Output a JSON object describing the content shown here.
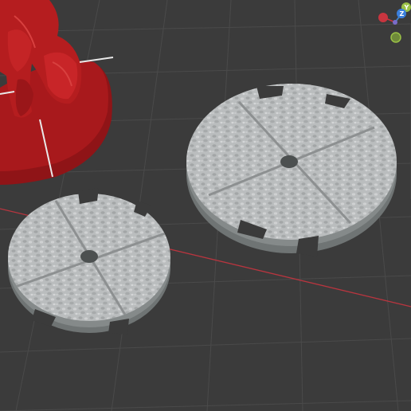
{
  "viewport": {
    "background": "#3b3b3b",
    "grid_color": "#4a4a4a",
    "x_axis_color": "#b8353f"
  },
  "scene": {
    "objects": [
      {
        "name": "miniature-figure",
        "color": "#a8191c"
      },
      {
        "name": "large-textured-base",
        "color": "#b9bcbd"
      },
      {
        "name": "small-textured-base",
        "color": "#b9bcbd"
      }
    ]
  },
  "view_gizmo": {
    "y_label": "Y",
    "z_label": "Z",
    "x_color": "#c8353f",
    "y_color": "#9ac146",
    "z_color": "#3a7fdc"
  }
}
